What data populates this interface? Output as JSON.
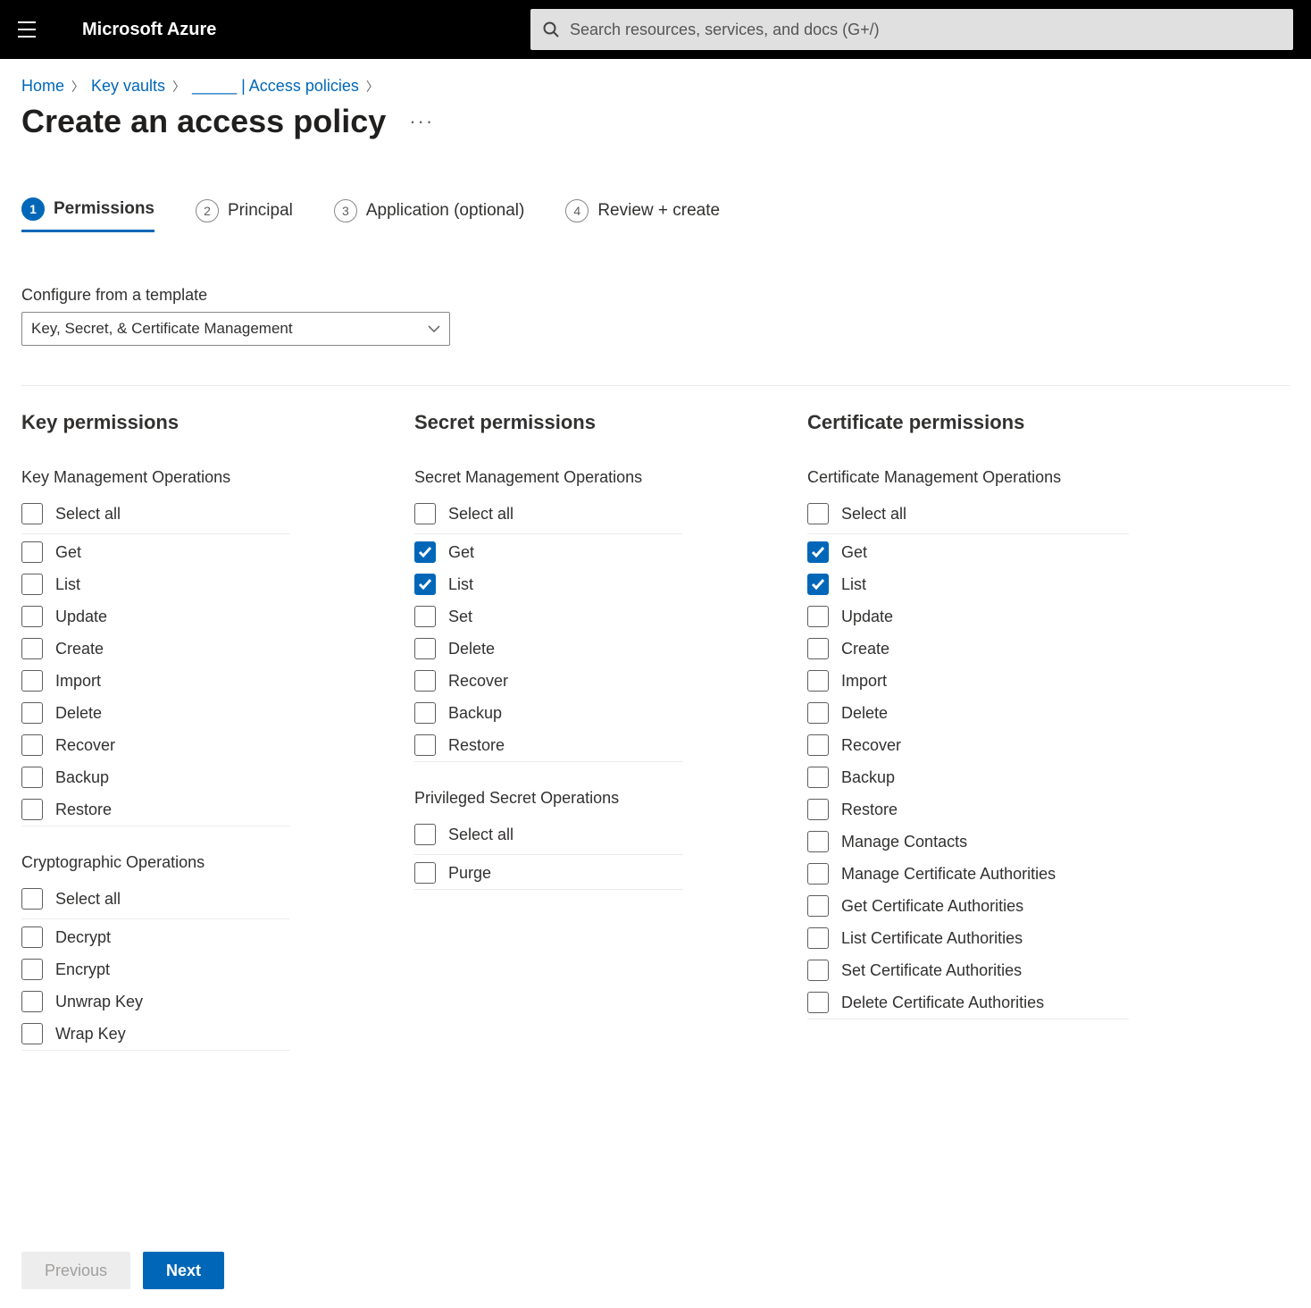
{
  "header": {
    "brand": "Microsoft Azure",
    "search_placeholder": "Search resources, services, and docs (G+/)"
  },
  "breadcrumbs": {
    "items": [
      "Home",
      "Key vaults",
      "_____ | Access policies"
    ]
  },
  "page": {
    "title": "Create an access policy"
  },
  "steps": [
    {
      "num": "1",
      "label": "Permissions",
      "active": true
    },
    {
      "num": "2",
      "label": "Principal",
      "active": false
    },
    {
      "num": "3",
      "label": "Application (optional)",
      "active": false
    },
    {
      "num": "4",
      "label": "Review + create",
      "active": false
    }
  ],
  "template": {
    "label": "Configure from a template",
    "selected": "Key, Secret, & Certificate Management"
  },
  "columns": [
    {
      "title": "Key permissions",
      "groups": [
        {
          "title": "Key Management Operations",
          "select_all_label": "Select all",
          "items": [
            {
              "label": "Get",
              "checked": false
            },
            {
              "label": "List",
              "checked": false
            },
            {
              "label": "Update",
              "checked": false
            },
            {
              "label": "Create",
              "checked": false
            },
            {
              "label": "Import",
              "checked": false
            },
            {
              "label": "Delete",
              "checked": false
            },
            {
              "label": "Recover",
              "checked": false
            },
            {
              "label": "Backup",
              "checked": false
            },
            {
              "label": "Restore",
              "checked": false
            }
          ]
        },
        {
          "title": "Cryptographic Operations",
          "select_all_label": "Select all",
          "items": [
            {
              "label": "Decrypt",
              "checked": false
            },
            {
              "label": "Encrypt",
              "checked": false
            },
            {
              "label": "Unwrap Key",
              "checked": false
            },
            {
              "label": "Wrap Key",
              "checked": false
            }
          ]
        }
      ]
    },
    {
      "title": "Secret permissions",
      "groups": [
        {
          "title": "Secret Management Operations",
          "select_all_label": "Select all",
          "items": [
            {
              "label": "Get",
              "checked": true
            },
            {
              "label": "List",
              "checked": true
            },
            {
              "label": "Set",
              "checked": false
            },
            {
              "label": "Delete",
              "checked": false
            },
            {
              "label": "Recover",
              "checked": false
            },
            {
              "label": "Backup",
              "checked": false
            },
            {
              "label": "Restore",
              "checked": false
            }
          ]
        },
        {
          "title": "Privileged Secret Operations",
          "select_all_label": "Select all",
          "items": [
            {
              "label": "Purge",
              "checked": false
            }
          ]
        }
      ]
    },
    {
      "title": "Certificate permissions",
      "groups": [
        {
          "title": "Certificate Management Operations",
          "select_all_label": "Select all",
          "items": [
            {
              "label": "Get",
              "checked": true
            },
            {
              "label": "List",
              "checked": true
            },
            {
              "label": "Update",
              "checked": false
            },
            {
              "label": "Create",
              "checked": false
            },
            {
              "label": "Import",
              "checked": false
            },
            {
              "label": "Delete",
              "checked": false
            },
            {
              "label": "Recover",
              "checked": false
            },
            {
              "label": "Backup",
              "checked": false
            },
            {
              "label": "Restore",
              "checked": false
            },
            {
              "label": "Manage Contacts",
              "checked": false
            },
            {
              "label": "Manage Certificate Authorities",
              "checked": false
            },
            {
              "label": "Get Certificate Authorities",
              "checked": false
            },
            {
              "label": "List Certificate Authorities",
              "checked": false
            },
            {
              "label": "Set Certificate Authorities",
              "checked": false
            },
            {
              "label": "Delete Certificate Authorities",
              "checked": false
            }
          ]
        }
      ]
    }
  ],
  "footer": {
    "previous": "Previous",
    "next": "Next"
  }
}
